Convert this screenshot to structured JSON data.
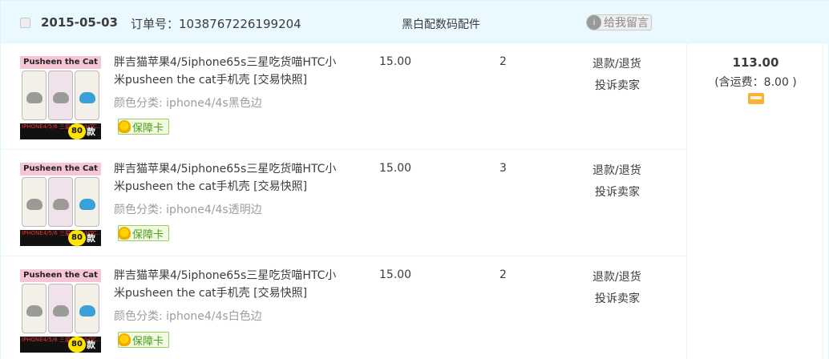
{
  "header": {
    "date": "2015-05-03",
    "order_label": "订单号：1038767226199204",
    "shop_name": "黑白配数码配件",
    "message_icon_text": "i",
    "message_button": "给我留言"
  },
  "items": [
    {
      "thumb_title": "Pusheen the Cat",
      "thumb_bottom": "IPHONE4/5/6 三星/小米/HTC..",
      "thumb_badge": "80",
      "thumb_kuan": "款",
      "title": "胖吉猫苹果4/5iphone65s三星吃货喵HTC小米pusheen the cat手机壳",
      "snapshot": "[交易快照]",
      "sku": "颜色分类: iphone4/4s黑色边",
      "guarantee": "保障卡",
      "price": "15.00",
      "qty": "2",
      "refund": "退款/退货",
      "complain": "投诉卖家"
    },
    {
      "thumb_title": "Pusheen the Cat",
      "thumb_bottom": "IPHONE4/5/6 三星/小米/HTC..",
      "thumb_badge": "80",
      "thumb_kuan": "款",
      "title": "胖吉猫苹果4/5iphone65s三星吃货喵HTC小米pusheen the cat手机壳",
      "snapshot": "[交易快照]",
      "sku": "颜色分类: iphone4/4s透明边",
      "guarantee": "保障卡",
      "price": "15.00",
      "qty": "3",
      "refund": "退款/退货",
      "complain": "投诉卖家"
    },
    {
      "thumb_title": "Pusheen the Cat",
      "thumb_bottom": "IPHONE4/5/6 三星/小米/HTC..",
      "thumb_badge": "80",
      "thumb_kuan": "款",
      "title": "胖吉猫苹果4/5iphone65s三星吃货喵HTC小米pusheen the cat手机壳",
      "snapshot": "[交易快照]",
      "sku": "颜色分类: iphone4/4s白色边",
      "guarantee": "保障卡",
      "price": "15.00",
      "qty": "2",
      "refund": "退款/退货",
      "complain": "投诉卖家"
    }
  ],
  "total": {
    "amount": "113.00",
    "shipping": "(含运费：8.00 )"
  },
  "colors": {
    "header_bg": "#eaf8ff",
    "border": "#daf3ff",
    "guarantee_green": "#4d9a1e",
    "pay_icon": "#f7b23b"
  },
  "icons": {
    "message": "message-icon",
    "guarantee": "guarantee-icon",
    "pay": "pay-card-icon"
  }
}
